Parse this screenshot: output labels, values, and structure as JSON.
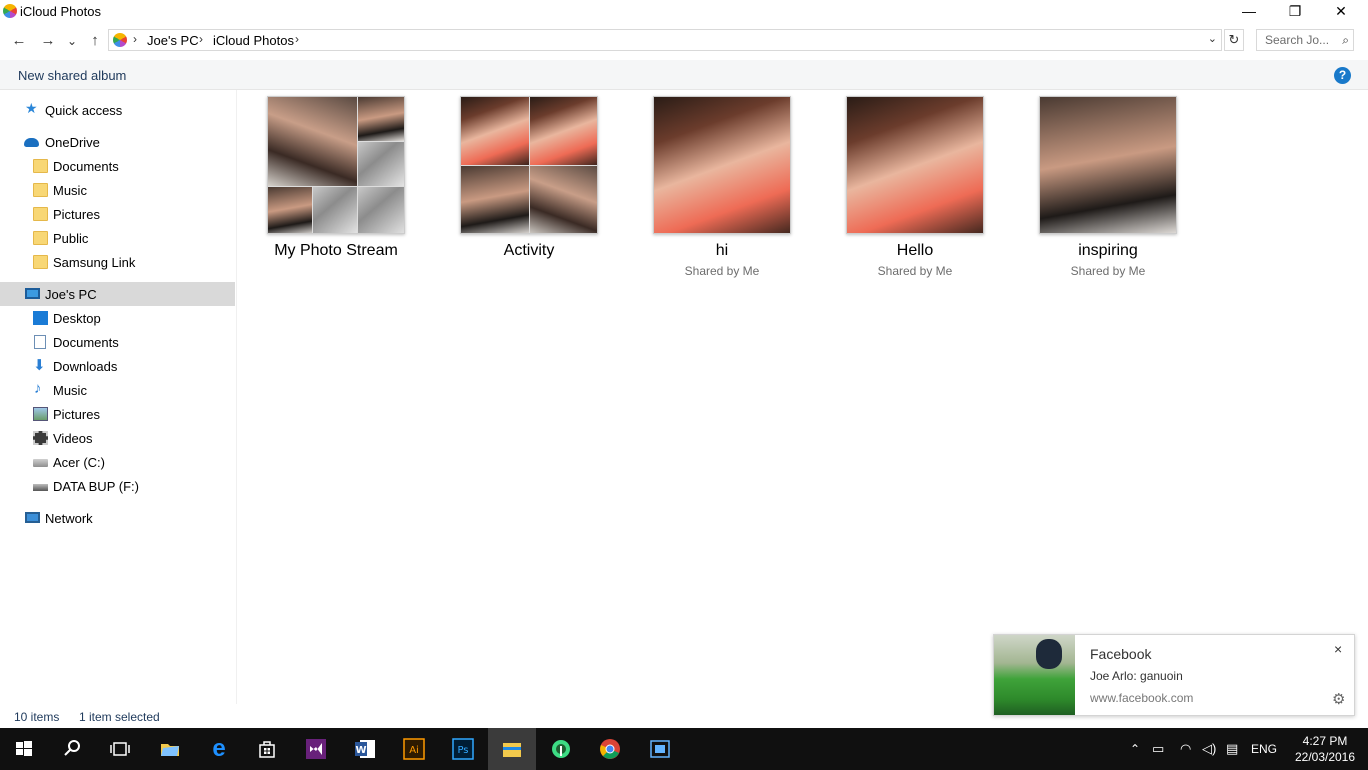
{
  "window": {
    "title": "iCloud Photos",
    "minimize": "—",
    "maximize": "❐",
    "close": "✕"
  },
  "nav": {
    "back": "←",
    "forward": "→",
    "recent": "⌄",
    "up": "↑",
    "breadcrumb": [
      "Joe's PC",
      "iCloud Photos"
    ],
    "refresh": "↻",
    "search_placeholder": "Search Jo...",
    "search_icon": "⌕"
  },
  "command_bar": {
    "new_shared_album": "New shared album",
    "help": "?"
  },
  "sidebar": {
    "quick_access": "Quick access",
    "onedrive": "OneDrive",
    "onedrive_items": [
      "Documents",
      "Music",
      "Pictures",
      "Public",
      "Samsung Link"
    ],
    "this_pc": "Joe's PC",
    "pc_items": [
      "Desktop",
      "Documents",
      "Downloads",
      "Music",
      "Pictures",
      "Videos",
      "Acer (C:)",
      "DATA BUP (F:)"
    ],
    "network": "Network"
  },
  "tiles": [
    {
      "name": "My Photo Stream",
      "subtitle": ""
    },
    {
      "name": "Activity",
      "subtitle": ""
    },
    {
      "name": "hi",
      "subtitle": "Shared by Me"
    },
    {
      "name": "Hello",
      "subtitle": "Shared by Me"
    },
    {
      "name": "inspiring",
      "subtitle": "Shared by Me"
    }
  ],
  "status": {
    "items": "10 items",
    "selected": "1 item selected"
  },
  "toast": {
    "title": "Facebook",
    "message": "Joe Arlo: ganuoin",
    "url": "www.facebook.com",
    "close": "×",
    "settings": "⚙"
  },
  "taskbar": {
    "language": "ENG",
    "time": "4:27 PM",
    "date": "22/03/2016",
    "tray_up": "⌃",
    "apps": [
      "start",
      "search",
      "task-view",
      "explorer-yellow",
      "edge",
      "store",
      "visual-studio",
      "word",
      "illustrator",
      "photoshop",
      "file-explorer",
      "android-studio",
      "chrome",
      "media"
    ]
  }
}
